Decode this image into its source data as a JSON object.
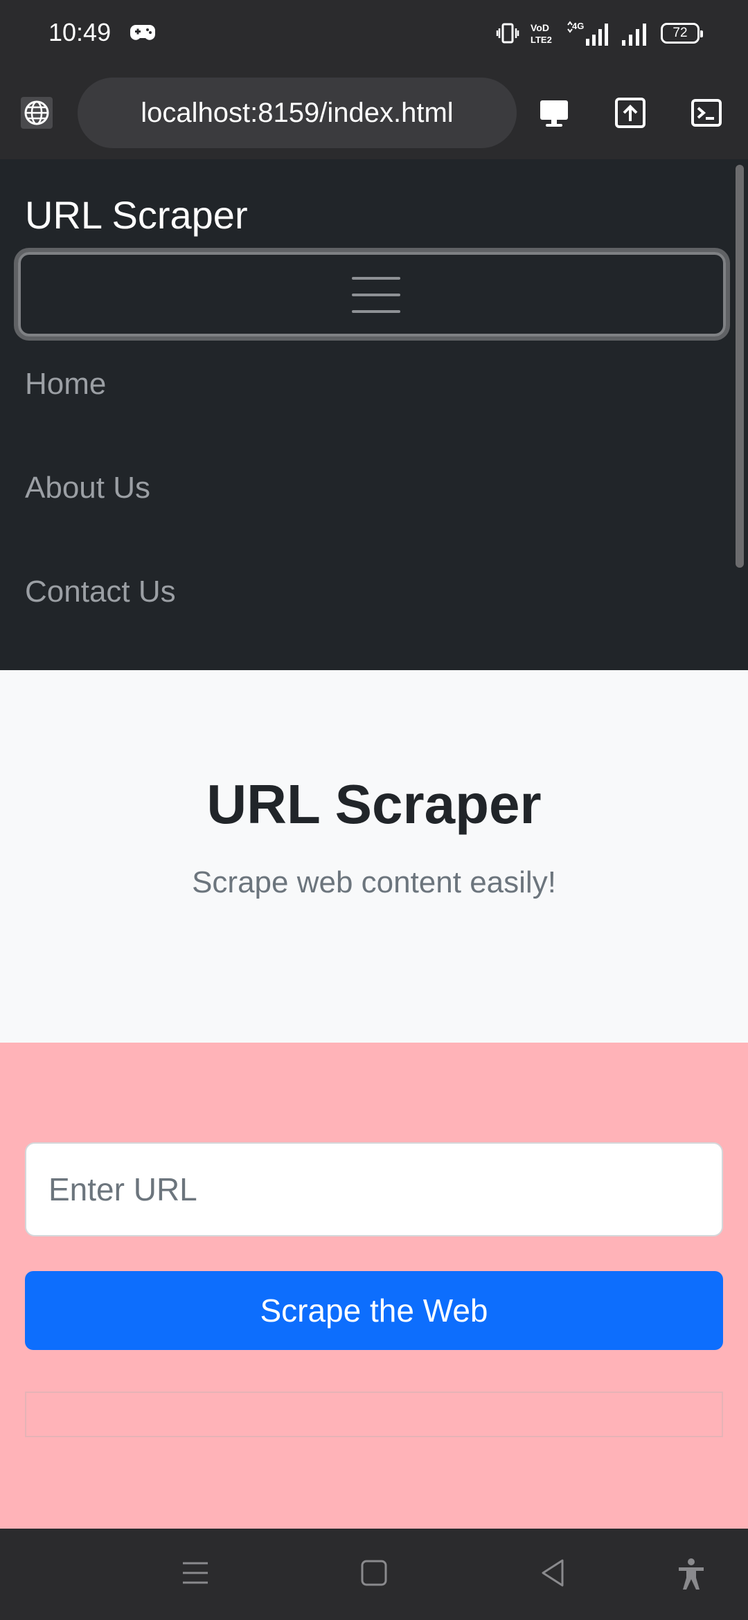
{
  "status_bar": {
    "time": "10:49",
    "battery": "72",
    "volte_label_top": "VoD",
    "volte_label_bottom": "LTE2",
    "network_label": "4G"
  },
  "browser": {
    "url": "localhost:8159/index.html"
  },
  "navbar": {
    "brand": "URL Scraper",
    "links": [
      "Home",
      "About Us",
      "Contact Us"
    ]
  },
  "hero": {
    "title": "URL Scraper",
    "subtitle": "Scrape web content easily!"
  },
  "form": {
    "url_placeholder": "Enter URL",
    "url_value": "",
    "submit_label": "Scrape the Web"
  },
  "colors": {
    "navbar_bg": "#212529",
    "hero_bg": "#f8f9fa",
    "form_bg": "#ffb3b8",
    "primary": "#0d6efd"
  }
}
